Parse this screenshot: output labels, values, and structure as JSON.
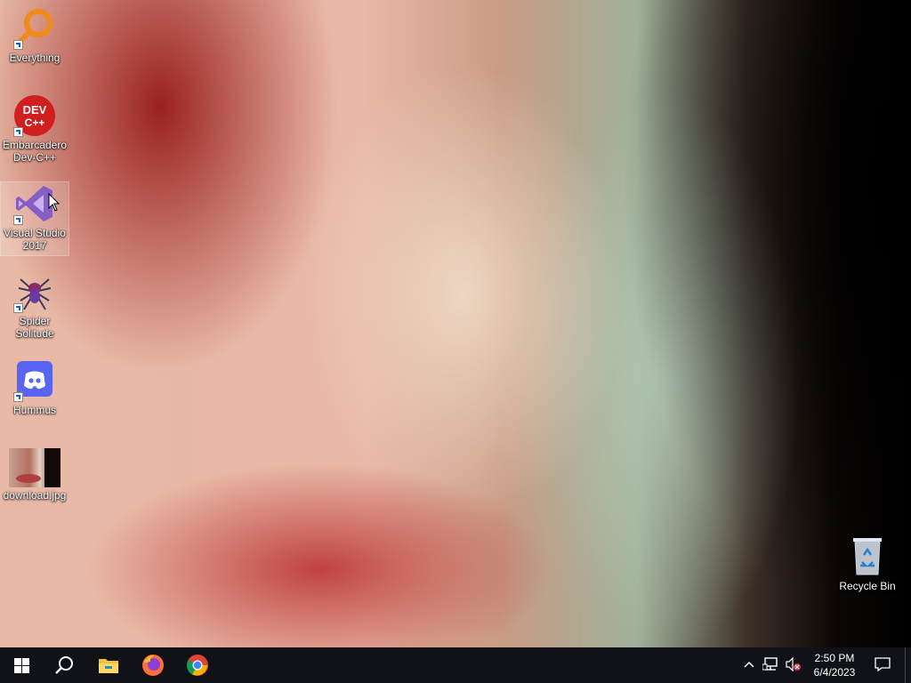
{
  "desktop": {
    "icons": [
      {
        "label": "Everything",
        "icon": "everything-magnifier-icon"
      },
      {
        "label": "Embarcadero Dev-C++",
        "icon": "devcpp-icon",
        "badge": "DEV C++"
      },
      {
        "label": "Visual Studio 2017",
        "icon": "visual-studio-icon"
      },
      {
        "label": "Spider Solitude",
        "icon": "spider-icon"
      },
      {
        "label": "Hummus",
        "icon": "discord-icon"
      },
      {
        "label": "download.jpg",
        "icon": "image-thumbnail-icon"
      }
    ],
    "recycle_bin": {
      "label": "Recycle Bin",
      "icon": "recycle-bin-icon"
    }
  },
  "taskbar": {
    "buttons": [
      "start-windows-icon",
      "search-icon",
      "file-explorer-icon",
      "firefox-icon",
      "chrome-icon"
    ],
    "tray": {
      "chevron": "chevron-up-icon",
      "network": "network-icon",
      "volume": "volume-muted-icon",
      "time": "2:50 PM",
      "date": "6/4/2023",
      "notifications": "notification-icon"
    }
  },
  "colors": {
    "taskbar_bg": "#101217",
    "accent_blue": "#0078d7",
    "vs_purple": "#865fc5"
  }
}
